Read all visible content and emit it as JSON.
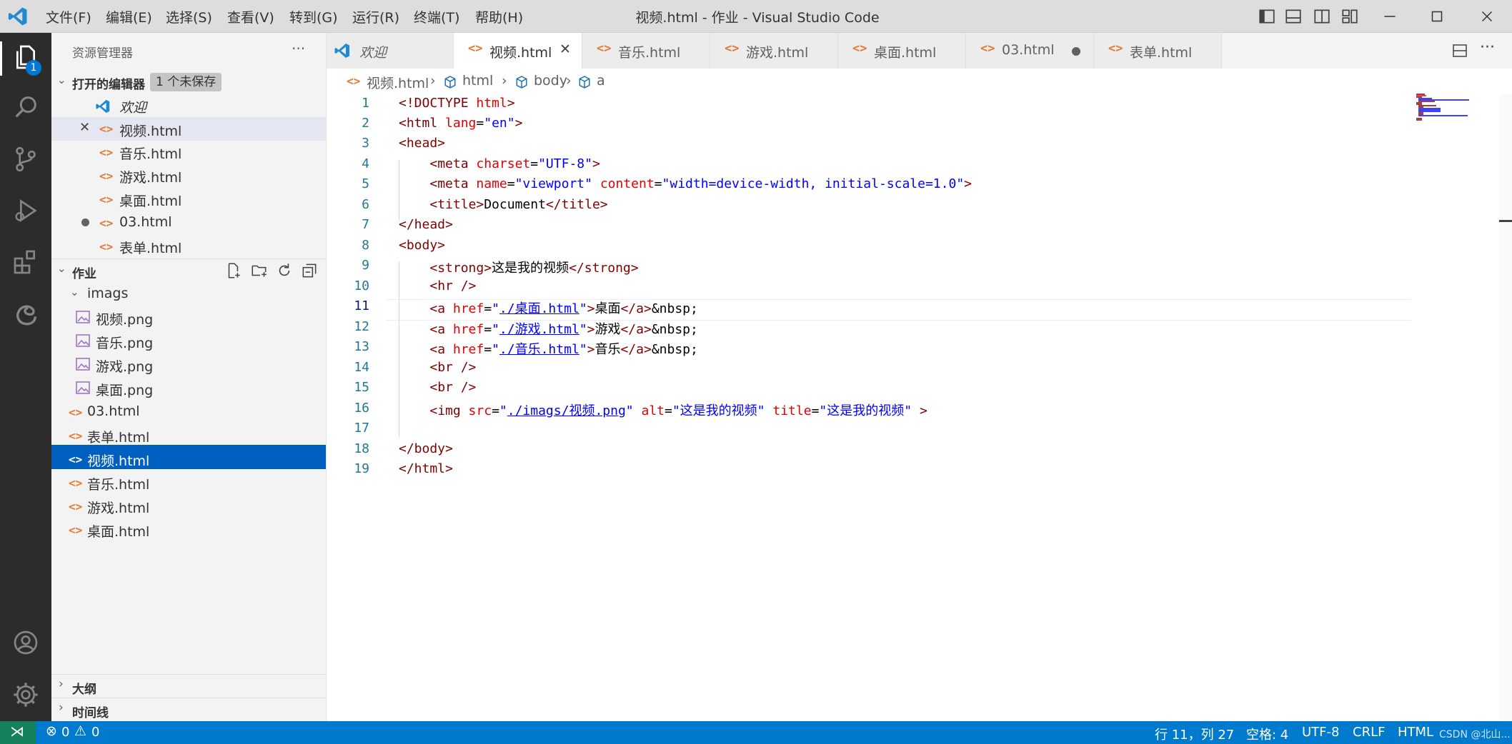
{
  "menu": [
    "文件(F)",
    "编辑(E)",
    "选择(S)",
    "查看(V)",
    "转到(G)",
    "运行(R)",
    "终端(T)",
    "帮助(H)"
  ],
  "window_title": "视频.html - 作业 - Visual Studio Code",
  "activity": {
    "explorer_badge": "1"
  },
  "sidebar": {
    "title": "资源管理器",
    "more": "···",
    "open_editors": {
      "label": "打开的编辑器",
      "badge": "1 个未保存",
      "items": [
        "欢迎",
        "视频.html",
        "音乐.html",
        "游戏.html",
        "桌面.html",
        "03.html",
        "表单.html"
      ]
    },
    "workspace": {
      "label": "作业",
      "folder": "imags",
      "folder_items": [
        "视频.png",
        "音乐.png",
        "游戏.png",
        "桌面.png"
      ],
      "items": [
        "03.html",
        "表单.html",
        "视频.html",
        "音乐.html",
        "游戏.html",
        "桌面.html"
      ]
    },
    "outline": "大纲",
    "timeline": "时间线"
  },
  "tabs": [
    "欢迎",
    "视频.html",
    "音乐.html",
    "游戏.html",
    "桌面.html",
    "03.html",
    "表单.html"
  ],
  "active_tab": "视频.html",
  "breadcrumb": [
    "视频.html",
    "html",
    "body",
    "a"
  ],
  "code": {
    "line_numbers": [
      "1",
      "2",
      "3",
      "4",
      "5",
      "6",
      "7",
      "8",
      "9",
      "10",
      "11",
      "12",
      "13",
      "14",
      "15",
      "16",
      "17",
      "18",
      "19"
    ],
    "current_line": 11
  },
  "status": {
    "errors": "0",
    "warnings": "0",
    "position": "行 11，列 27",
    "spaces": "空格: 4",
    "encoding": "UTF-8",
    "eol": "CRLF",
    "language": "HTML",
    "watermark": "CSDN @北山..."
  },
  "colors": {
    "accent": "#007acc",
    "selection": "#0060c0",
    "activity_bar": "#2c2c2c"
  }
}
